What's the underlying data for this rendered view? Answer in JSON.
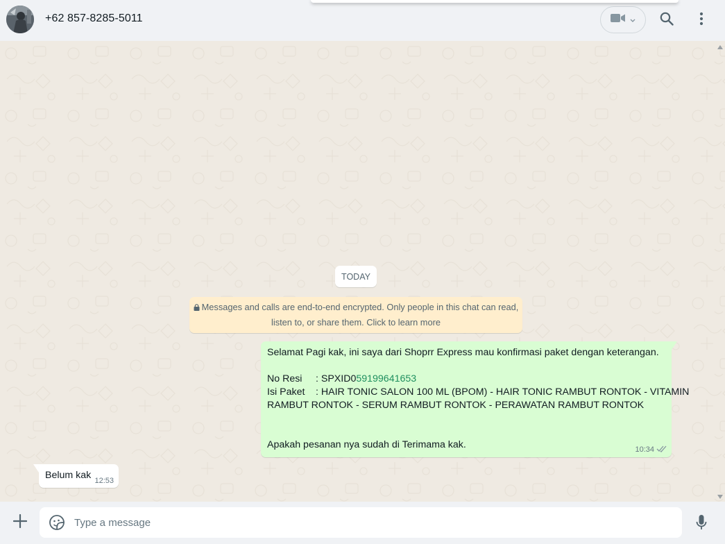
{
  "header": {
    "contact_name": "+62 857-8285-5011"
  },
  "chat": {
    "date_chip": "TODAY",
    "encryption_notice_line1": "Messages and calls are end-to-end encrypted. Only people in this chat can read,",
    "encryption_notice_line2": "listen to, or share them. Click to learn more",
    "outgoing": {
      "greeting": "Selamat Pagi kak, ini saya dari Shoprr Express mau konfirmasi paket dengan keterangan.",
      "resi_label": "No Resi",
      "resi_prefix": ": SPXID0",
      "resi_number": "59199641653",
      "isi_label": "Isi Paket",
      "isi_line1": ": HAIR TONIC SALON 100 ML (BPOM) - HAIR TONIC RAMBUT RONTOK - VITAMIN",
      "isi_line2": "RAMBUT RONTOK - SERUM RAMBUT RONTOK - PERAWATAN RAMBUT RONTOK",
      "question": "Apakah pesanan nya sudah di Terimama kak.",
      "time": "10:34",
      "status_icon": "double-check-icon"
    },
    "incoming": {
      "text": "Belum kak",
      "time": "12:53"
    }
  },
  "footer": {
    "placeholder": "Type a message"
  },
  "colors": {
    "chat_bg": "#efeae2",
    "outgoing_bubble": "#d9fdd3",
    "incoming_bubble": "#ffffff",
    "encryption_bg": "#ffeecd",
    "panel_bg": "#f0f2f5"
  }
}
